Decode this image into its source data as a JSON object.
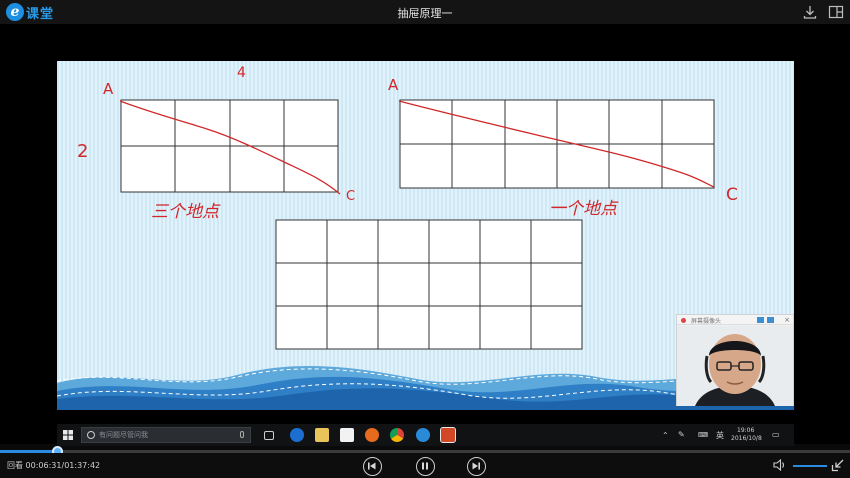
{
  "app": {
    "logo_letter": "e",
    "logo_text": "课堂",
    "title": "抽屉原理一"
  },
  "titlebar": {
    "icons": [
      "download-icon",
      "window-mode-icon"
    ]
  },
  "slide": {
    "grid_top_left": {
      "label_a": "A",
      "label_c": "C",
      "top_number": "4",
      "side_number": "2",
      "caption": "三个地点"
    },
    "grid_top_right": {
      "label_a": "A",
      "label_c": "C",
      "caption": "一个地点"
    },
    "grid_bottom": {
      "rows": 3,
      "cols": 6
    },
    "annotation_color": "#d0282a"
  },
  "webcam": {
    "title": "屏幕摄像头"
  },
  "windows_taskbar": {
    "search_placeholder": "有问题尽管问我",
    "tray_lang": "英",
    "clock_time": "19:06",
    "clock_date": "2016/10/8",
    "apps": [
      "task-view-icon",
      "edge-icon",
      "file-explorer-icon",
      "store-icon",
      "firefox-icon",
      "chrome-icon",
      "ie-icon",
      "powerpoint-icon"
    ]
  },
  "player": {
    "mode_label": "回看",
    "current_time": "00:06:31",
    "total_time": "01:37:42",
    "time_separator": "/",
    "progress": 0.0667,
    "controls": [
      "previous-icon",
      "pause-icon",
      "next-icon"
    ],
    "volume": 1.0,
    "accent_color": "#2a8be0"
  }
}
